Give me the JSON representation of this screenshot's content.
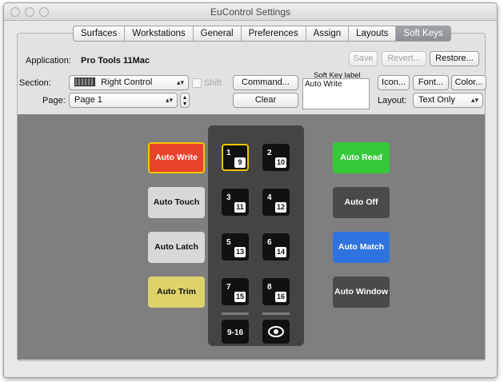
{
  "window": {
    "title": "EuControl Settings"
  },
  "tabs": [
    "Surfaces",
    "Workstations",
    "General",
    "Preferences",
    "Assign",
    "Layouts",
    "Soft Keys"
  ],
  "active_tab": "Soft Keys",
  "application": {
    "label": "Application:",
    "value": "Pro Tools 11Mac"
  },
  "header_buttons": {
    "save": "Save",
    "revert": "Revert...",
    "restore": "Restore..."
  },
  "section": {
    "label": "Section:",
    "value": "Right Control"
  },
  "shift_label": "Shift",
  "page": {
    "label": "Page:",
    "value": "Page 1"
  },
  "command_button": "Command...",
  "clear_button": "Clear",
  "soft_key_label": {
    "title": "Soft Key label",
    "value": "Auto Write"
  },
  "icon_button": "Icon...",
  "font_button": "Font...",
  "color_button": "Color...",
  "layout": {
    "label": "Layout:",
    "value": "Text Only"
  },
  "left_keys": [
    {
      "label": "Auto Write",
      "bg": "#e8432a",
      "fg": "#ffffff",
      "border": "#f4c400"
    },
    {
      "label": "Auto Touch",
      "bg": "#d8d8d8",
      "fg": "#111111",
      "border": ""
    },
    {
      "label": "Auto Latch",
      "bg": "#d8d8d8",
      "fg": "#111111",
      "border": ""
    },
    {
      "label": "Auto Trim",
      "bg": "#ded26b",
      "fg": "#111111",
      "border": ""
    }
  ],
  "right_keys": [
    {
      "label": "Auto Read",
      "bg": "#35c93a",
      "fg": "#ffffff"
    },
    {
      "label": "Auto Off",
      "bg": "#4a4a4a",
      "fg": "#ffffff"
    },
    {
      "label": "Auto Match",
      "bg": "#2f73e0",
      "fg": "#ffffff"
    },
    {
      "label": "Auto Window",
      "bg": "#4a4a4a",
      "fg": "#ffffff"
    }
  ],
  "pads": [
    {
      "top": "1",
      "bottom": "9"
    },
    {
      "top": "2",
      "bottom": "10"
    },
    {
      "top": "3",
      "bottom": "11"
    },
    {
      "top": "4",
      "bottom": "12"
    },
    {
      "top": "5",
      "bottom": "13"
    },
    {
      "top": "6",
      "bottom": "14"
    },
    {
      "top": "7",
      "bottom": "15"
    },
    {
      "top": "8",
      "bottom": "16"
    }
  ],
  "bank_button": "9-16",
  "eye_icon": "eye-icon"
}
